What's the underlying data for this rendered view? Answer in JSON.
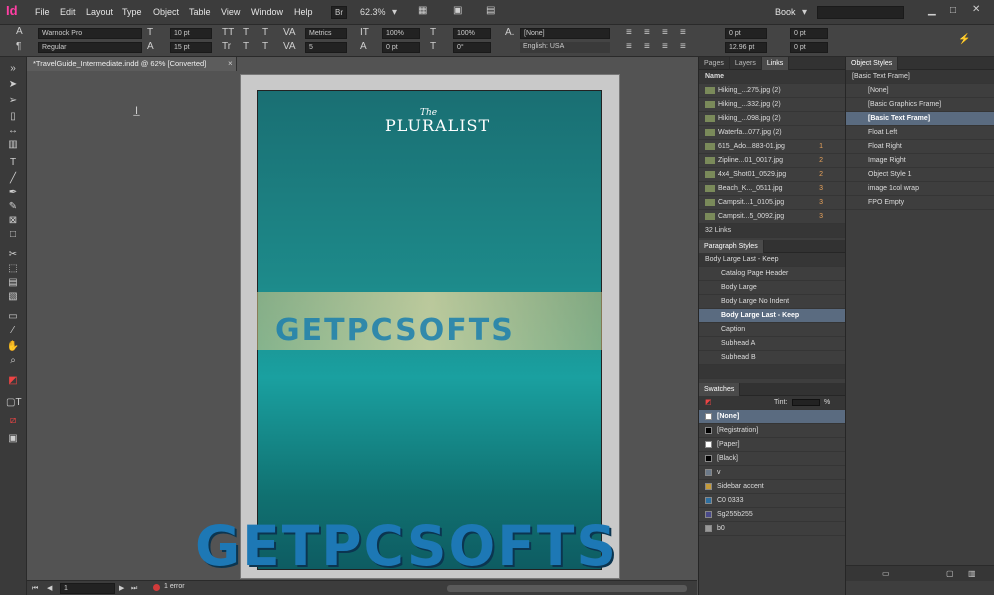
{
  "app": {
    "logo": "Id"
  },
  "menu": [
    "File",
    "Edit",
    "Layout",
    "Type",
    "Object",
    "Table",
    "View",
    "Window",
    "Help"
  ],
  "topbar": {
    "br": "Br",
    "zoom": "62.3%",
    "workspace": "Book"
  },
  "control": {
    "font": "Warnock Pro",
    "style": "Regular",
    "size": "10 pt",
    "leading": "15 pt",
    "kerning": "Metrics",
    "tracking": "5",
    "scale_v": "100%",
    "scale_h": "100%",
    "baseline": "0 pt",
    "skew": "0°",
    "char_style": "[None]",
    "language": "English: USA",
    "indent_l": "0 pt",
    "indent_r": "0 pt",
    "space_b": "12.96 pt",
    "space_a": "0 pt",
    "first": "0 pt",
    "last": "0 pt"
  },
  "doc": {
    "tab": "*TravelGuide_Intermediate.indd @ 62% [Converted]",
    "title_small": "The",
    "title": "PLURALIST",
    "watermark": "GETPCSOFTS"
  },
  "status": {
    "page": "1",
    "errors": "1 error"
  },
  "links": {
    "tabs": [
      "Pages",
      "Layers",
      "Links"
    ],
    "header": "Name",
    "count": "32 Links",
    "items": [
      {
        "name": "Hiking_...275.jpg (2)",
        "n": ""
      },
      {
        "name": "Hiking_...332.jpg (2)",
        "n": ""
      },
      {
        "name": "Hiking_...098.jpg (2)",
        "n": ""
      },
      {
        "name": "Waterfa...077.jpg (2)",
        "n": ""
      },
      {
        "name": "615_Ado...883-01.jpg",
        "n": "1"
      },
      {
        "name": "Zipline...01_0017.jpg",
        "n": "2"
      },
      {
        "name": "4x4_Shot01_0529.jpg",
        "n": "2"
      },
      {
        "name": "Beach_K..._0511.jpg",
        "n": "3"
      },
      {
        "name": "Campsit...1_0105.jpg",
        "n": "3"
      },
      {
        "name": "Campsit...5_0092.jpg",
        "n": "3"
      }
    ]
  },
  "para": {
    "title": "Paragraph Styles",
    "current": "Body Large Last - Keep",
    "items": [
      "Catalog Page Header",
      "Body Large",
      "Body Large No Indent",
      "Body Large Last - Keep",
      "Caption",
      "Subhead A",
      "Subhead B"
    ]
  },
  "swatches": {
    "title": "Swatches",
    "tint": "Tint:",
    "pct": "%",
    "items": [
      {
        "name": "[None]",
        "color": "#ffffff"
      },
      {
        "name": "[Registration]",
        "color": "#000000"
      },
      {
        "name": "[Paper]",
        "color": "#ffffff"
      },
      {
        "name": "[Black]",
        "color": "#000000"
      },
      {
        "name": "v",
        "color": "#6c7a8a"
      },
      {
        "name": "Sidebar accent",
        "color": "#c49a3a"
      },
      {
        "name": "C0 0333",
        "color": "#2d6fa0"
      },
      {
        "name": "Sg255b255",
        "color": "#4a4a8a"
      },
      {
        "name": "b0",
        "color": "#999999"
      }
    ]
  },
  "objstyles": {
    "title": "Object Styles",
    "current": "[Basic Text Frame]",
    "items": [
      "[None]",
      "[Basic Graphics Frame]",
      "[Basic Text Frame]",
      "Float Left",
      "Float Right",
      "Image Right",
      "Object Style 1",
      "image 1col wrap",
      "FPO Empty"
    ]
  }
}
